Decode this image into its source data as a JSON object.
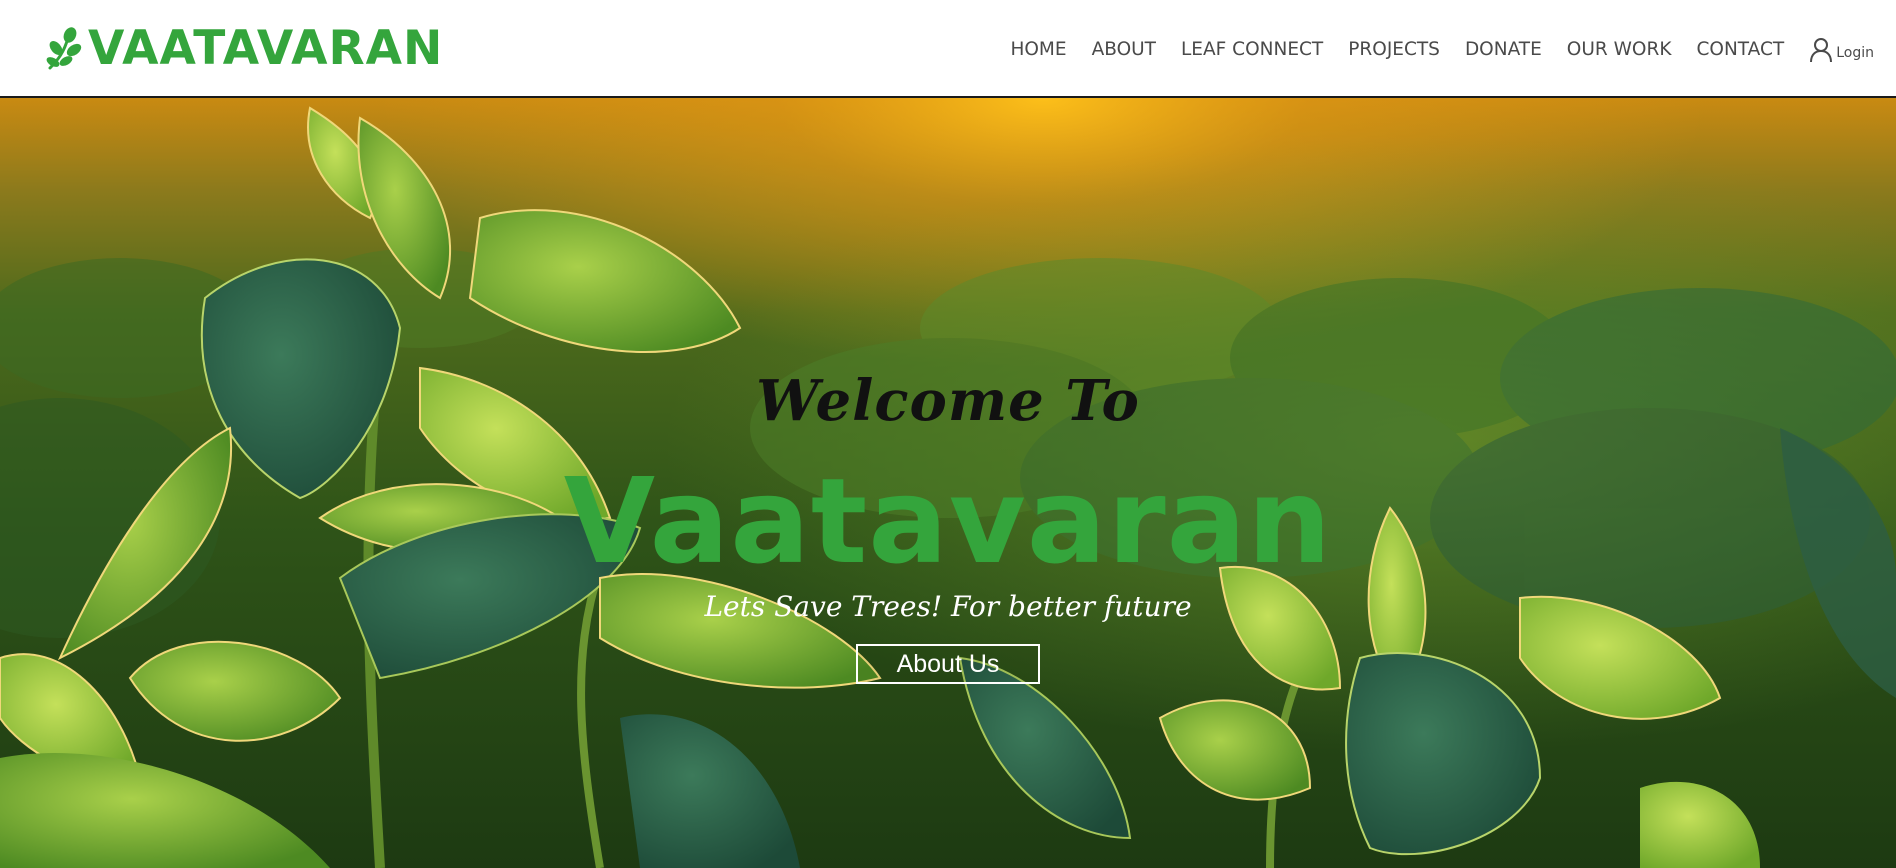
{
  "brand": {
    "name": "VAATAVARAN",
    "icon": "leaf-sprig-icon",
    "color": "#34a53c"
  },
  "nav": {
    "items": [
      {
        "label": "HOME"
      },
      {
        "label": "ABOUT"
      },
      {
        "label": "LEAF CONNECT"
      },
      {
        "label": "PROJECTS"
      },
      {
        "label": "DONATE"
      },
      {
        "label": "OUR WORK"
      },
      {
        "label": "CONTACT"
      }
    ],
    "login": {
      "label": "Login",
      "icon": "user-icon"
    }
  },
  "hero": {
    "welcome": "Welcome To",
    "title": "Vaatavaran",
    "tagline": "Lets Save Trees! For better future",
    "button_label": "About Us",
    "background": "sunlit-crop-field-image"
  }
}
